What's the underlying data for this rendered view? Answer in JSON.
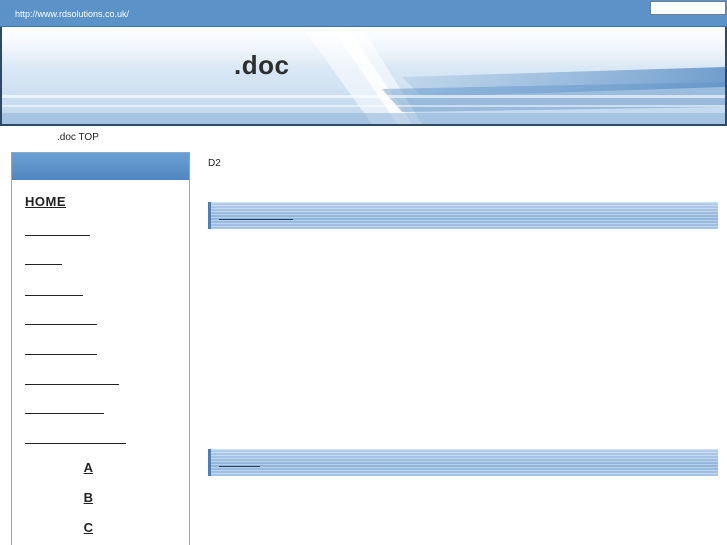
{
  "topbar": {
    "url": "http://www.rdsolutions.co.uk/",
    "search_value": ""
  },
  "banner": {
    "title": ".doc"
  },
  "breadcrumb": {
    "label": ".doc TOP"
  },
  "sidebar": {
    "items": [
      {
        "label": "HOME"
      },
      {
        "label": ""
      },
      {
        "label": ""
      },
      {
        "label": ""
      },
      {
        "label": ""
      },
      {
        "label": ""
      },
      {
        "label": ""
      },
      {
        "label": ""
      },
      {
        "label": ""
      },
      {
        "label": "A"
      },
      {
        "label": "B"
      },
      {
        "label": "C"
      }
    ]
  },
  "main": {
    "label": "D2",
    "sections": [
      {
        "link": ""
      },
      {
        "link": ""
      }
    ]
  },
  "colors": {
    "topbar": "#5b93c9",
    "sidebar_header": "#5a92c9",
    "section_bar": "#9fc0e2",
    "section_accent": "#4d7fb4"
  }
}
